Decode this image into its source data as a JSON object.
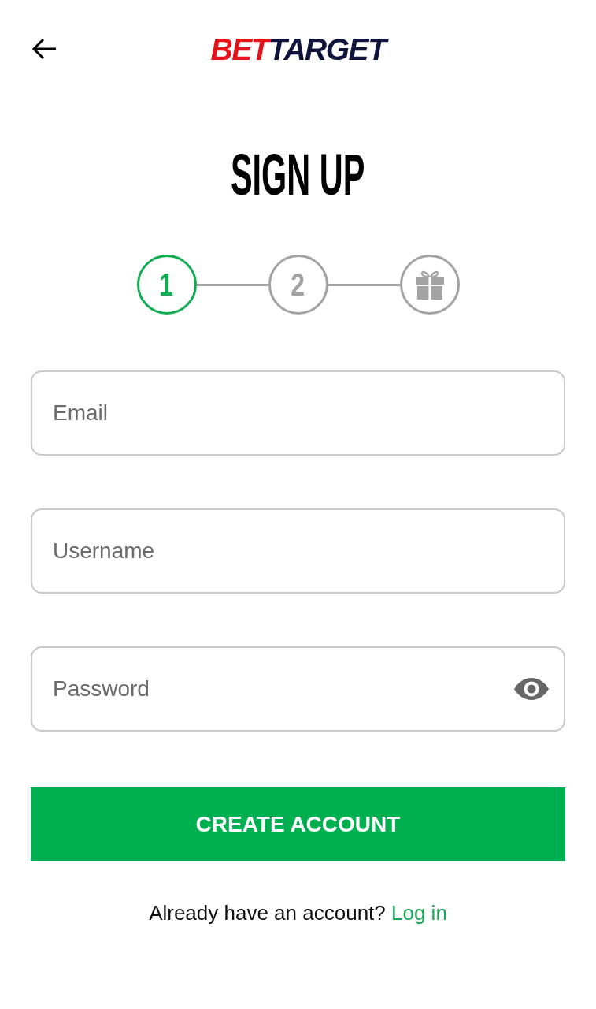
{
  "header": {
    "logo_parts": [
      {
        "text": "BET",
        "color": "#e3141b"
      },
      {
        "text": "TARGET",
        "color": "#10143a"
      }
    ]
  },
  "title": "SIGN UP",
  "steps": [
    {
      "kind": "number",
      "label": "1",
      "current": true
    },
    {
      "kind": "number",
      "label": "2",
      "current": false
    },
    {
      "kind": "gift",
      "current": false
    }
  ],
  "fields": [
    {
      "kind": "text",
      "placeholder": "Email"
    },
    {
      "kind": "text",
      "placeholder": "Username"
    },
    {
      "kind": "password",
      "placeholder": "Password"
    }
  ],
  "submit_button": "CREATE ACCOUNT",
  "footer": {
    "prompt": "Already have an account?",
    "link": "Log in"
  }
}
